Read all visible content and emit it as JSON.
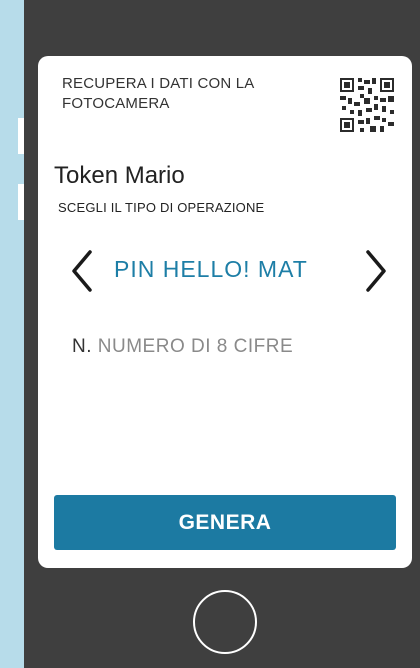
{
  "screen": {
    "camera_recovery_text": "RECUPERA I DATI CON LA FOTOCAMERA",
    "token_name": "Token Mario",
    "operation_label": "SCEGLI IL TIPO DI OPERAZIONE",
    "operation_value": "PIN HELLO! MAT",
    "number_prefix": "N.",
    "number_placeholder": "NUMERO DI 8 CIFRE",
    "generate_label": "GENERA"
  },
  "colors": {
    "accent": "#1c7aa2",
    "phone_body": "#3f3f3f",
    "background": "#b7dcea"
  },
  "icons": [
    "qr-code-icon",
    "chevron-left-icon",
    "chevron-right-icon",
    "home-button-icon"
  ]
}
